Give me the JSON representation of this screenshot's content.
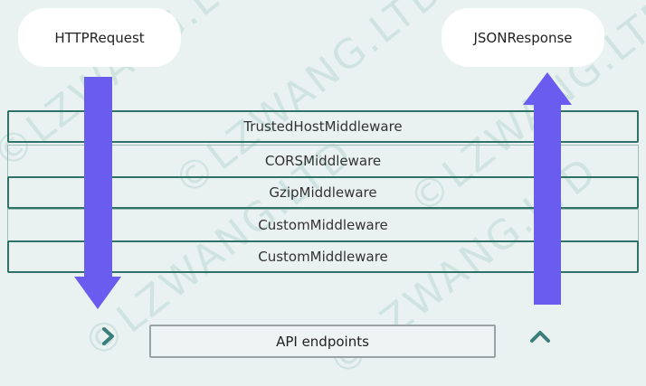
{
  "request_label": "HTTPRequest",
  "response_label": "JSONResponse",
  "middlewares": [
    "TrustedHostMiddleware",
    "CORSMiddleware",
    "GzipMiddleware",
    "CustomMiddleware",
    "CustomMiddleware"
  ],
  "endpoint_label": "API endpoints",
  "watermark_text": "©LZWANG.LTD",
  "colors": {
    "arrow": "#6b5cf0",
    "layer_border_dark": "#2f7266",
    "layer_border_light": "#9fbbb6",
    "icon": "#3a7e7c",
    "background": "#e9f2f0"
  }
}
